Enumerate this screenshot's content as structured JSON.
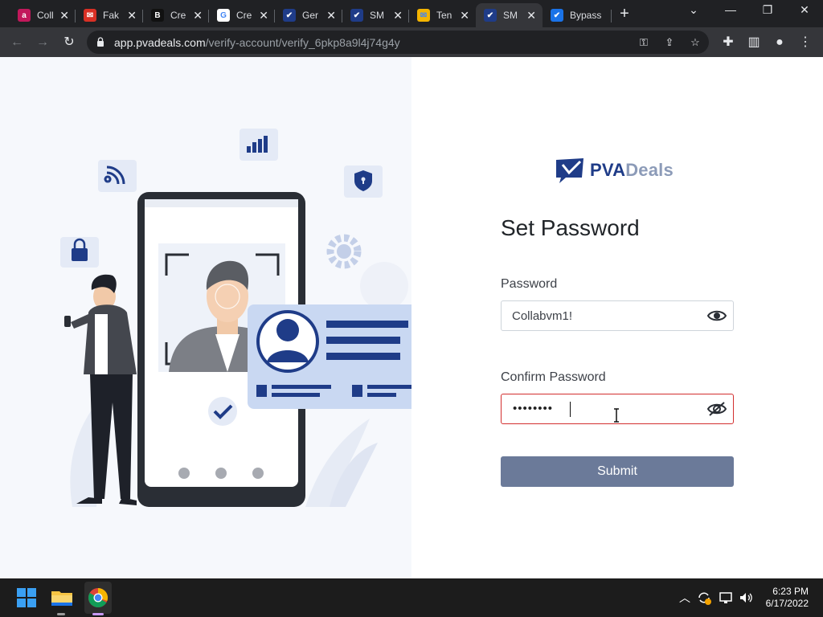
{
  "browser": {
    "tabs": [
      {
        "title": "Coll",
        "color": "#c2185b",
        "glyph": "a"
      },
      {
        "title": "Fak",
        "color": "#d93025",
        "glyph": "✉"
      },
      {
        "title": "Cre",
        "color": "#111111",
        "glyph": "B"
      },
      {
        "title": "Cre",
        "color": "#ffffff",
        "glyph": "G"
      },
      {
        "title": "Ger",
        "color": "#1f3c88",
        "glyph": "✔"
      },
      {
        "title": "SM",
        "color": "#1f3c88",
        "glyph": "✔"
      },
      {
        "title": "Ten",
        "color": "#f4b400",
        "glyph": "✉"
      },
      {
        "title": "SM",
        "color": "#1f3c88",
        "glyph": "✔"
      },
      {
        "title": "Bypass",
        "color": "#1a73e8",
        "glyph": "✔"
      }
    ],
    "close_glyph": "✕",
    "new_tab_glyph": "+",
    "url_host": "app.pvadeals.com",
    "url_path": "/verify-account/verify_6pkp8a9l4j74g4y"
  },
  "brand": {
    "name_part1": "PVA",
    "name_part2": "Deals"
  },
  "form": {
    "title": "Set Password",
    "password_label": "Password",
    "password_value": "Collabvm1!",
    "confirm_label": "Confirm Password",
    "confirm_masked": "••••••••",
    "submit_label": "Submit"
  },
  "taskbar": {
    "time": "6:23 PM",
    "date": "6/17/2022"
  },
  "colors": {
    "brand_dark": "#1f3c88",
    "brand_light": "#8c9bb8",
    "button": "#6b7a99",
    "error": "#d32f2f"
  }
}
